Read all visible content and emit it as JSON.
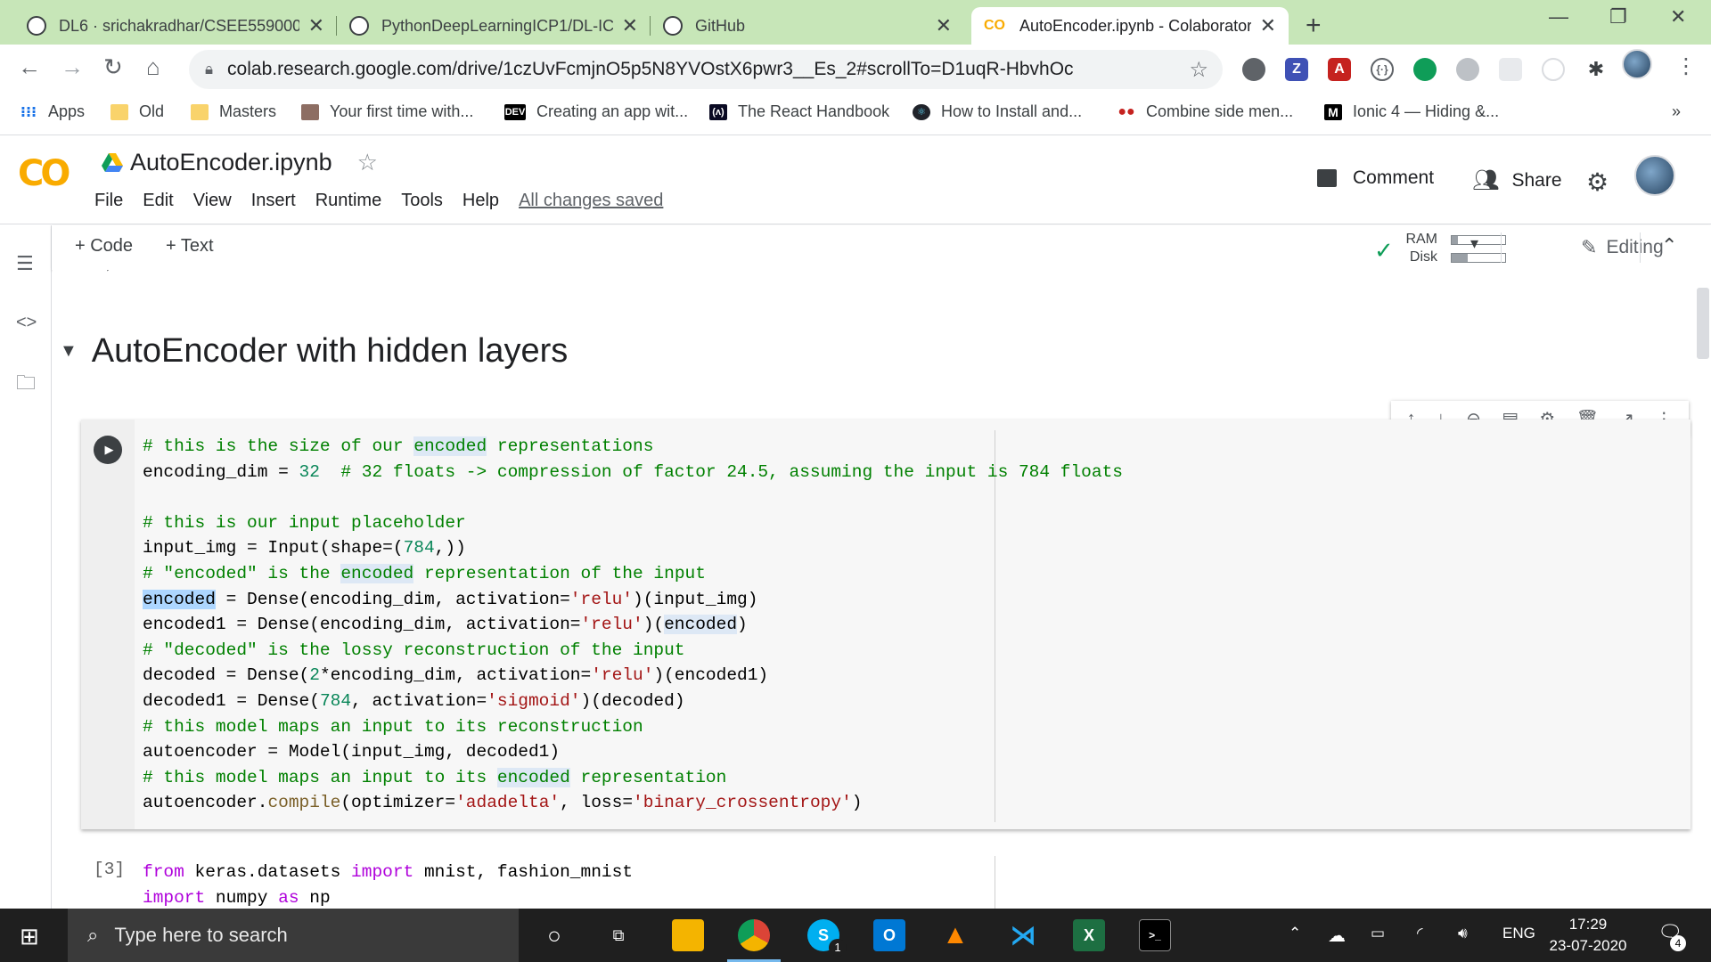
{
  "tabs": [
    {
      "title": "DL6 · srichakradhar/CSEE5590000",
      "icon": "github-icon"
    },
    {
      "title": "PythonDeepLearningICP1/DL-ICP",
      "icon": "github-icon"
    },
    {
      "title": "GitHub",
      "icon": "github-icon"
    },
    {
      "title": "AutoEncoder.ipynb - Colaboratory",
      "icon": "colab-icon"
    }
  ],
  "url": "colab.research.google.com/drive/1czUvFcmjnO5p5N8YVOstX6pwr3__Es_2#scrollTo=D1uqR-HbvhOc",
  "bookmarks": [
    {
      "label": "Apps",
      "icon": "apps-grid-icon"
    },
    {
      "label": "Old",
      "icon": "folder-icon"
    },
    {
      "label": "Masters",
      "icon": "folder-icon"
    },
    {
      "label": "Your first time with...",
      "icon": "bookmark-icon"
    },
    {
      "label": "Creating an app wit...",
      "icon": "dev-icon"
    },
    {
      "label": "The React Handbook",
      "icon": "freecodecamp-icon"
    },
    {
      "label": "How to Install and...",
      "icon": "react-icon"
    },
    {
      "label": "Combine side men...",
      "icon": "bookmark-icon"
    },
    {
      "label": "Ionic 4 — Hiding &...",
      "icon": "medium-icon"
    }
  ],
  "bookmarks_more": "»",
  "colab": {
    "logo": "CO",
    "notebook_title": "AutoEncoder.ipynb",
    "menu": [
      "File",
      "Edit",
      "View",
      "Insert",
      "Runtime",
      "Tools",
      "Help"
    ],
    "save_status": "All changes saved",
    "comment": "Comment",
    "share": "Share"
  },
  "notebook_toolbar": {
    "add_code": "+ Code",
    "add_text": "+ Text",
    "ram_label": "RAM",
    "disk_label": "Disk",
    "ram_fraction": 0.12,
    "disk_fraction": 0.3,
    "editing": "Editing"
  },
  "section_title": "AutoEncoder with hidden layers",
  "cell2_count": "[3]",
  "taskbar": {
    "search_placeholder": "Type here to search",
    "language": "ENG",
    "time": "17:29",
    "date": "23-07-2020",
    "notification_count": "4",
    "skype_badge": "1"
  },
  "colors": {
    "tab_strip": "#c7e6b8",
    "colab_orange": "#f9ab00",
    "comment_green": "#008000",
    "string_red": "#a31515",
    "keyword_purple": "#af00db"
  }
}
